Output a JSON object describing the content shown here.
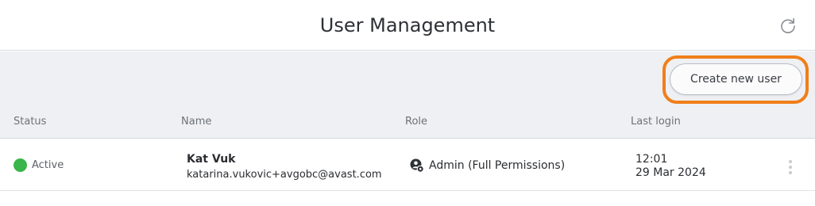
{
  "header": {
    "title": "User Management",
    "refresh_icon": "refresh-icon"
  },
  "toolbar": {
    "create_label": "Create new user",
    "highlight_color": "#f07f1a"
  },
  "table": {
    "columns": [
      "Status",
      "Name",
      "Role",
      "Last login"
    ],
    "rows": [
      {
        "status": "Active",
        "status_color": "#39b54a",
        "name": "Kat Vuk",
        "email": "katarina.vukovic+avgobc@avast.com",
        "role": "Admin (Full Permissions)",
        "role_icon": "admin-user-gear-icon",
        "last_login_time": "12:01",
        "last_login_date": "29 Mar 2024",
        "menu_icon": "kebab-menu-icon"
      }
    ]
  }
}
